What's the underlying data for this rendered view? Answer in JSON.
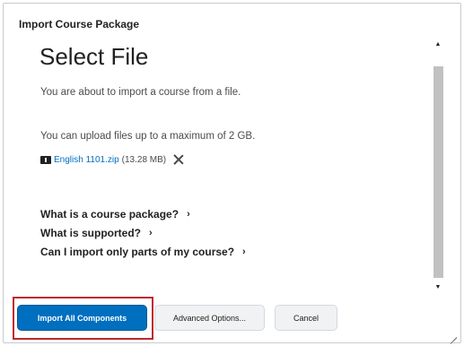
{
  "dialog": {
    "title": "Import Course Package"
  },
  "page": {
    "heading": "Select File",
    "intro": "You are about to import a course from a file.",
    "upload_limit": "You can upload files up to a maximum of 2 GB."
  },
  "file": {
    "icon": "zip-file-icon",
    "name": "English 1101.zip",
    "size": "(13.28 MB)",
    "remove_icon": "close-icon"
  },
  "help_links": [
    {
      "label": "What is a course package?",
      "icon": "chevron-right-icon",
      "glyph": "›"
    },
    {
      "label": "What is supported?",
      "icon": "chevron-right-icon",
      "glyph": "›"
    },
    {
      "label": "Can I import only parts of my course?",
      "icon": "chevron-right-icon",
      "glyph": "›"
    }
  ],
  "scrollbar": {
    "up_glyph": "▲",
    "down_glyph": "▼"
  },
  "footer": {
    "primary_label": "Import All Components",
    "advanced_label": "Advanced Options...",
    "cancel_label": "Cancel"
  },
  "colors": {
    "primary": "#006fbf",
    "highlight": "#c0262d",
    "link": "#006fbf"
  }
}
